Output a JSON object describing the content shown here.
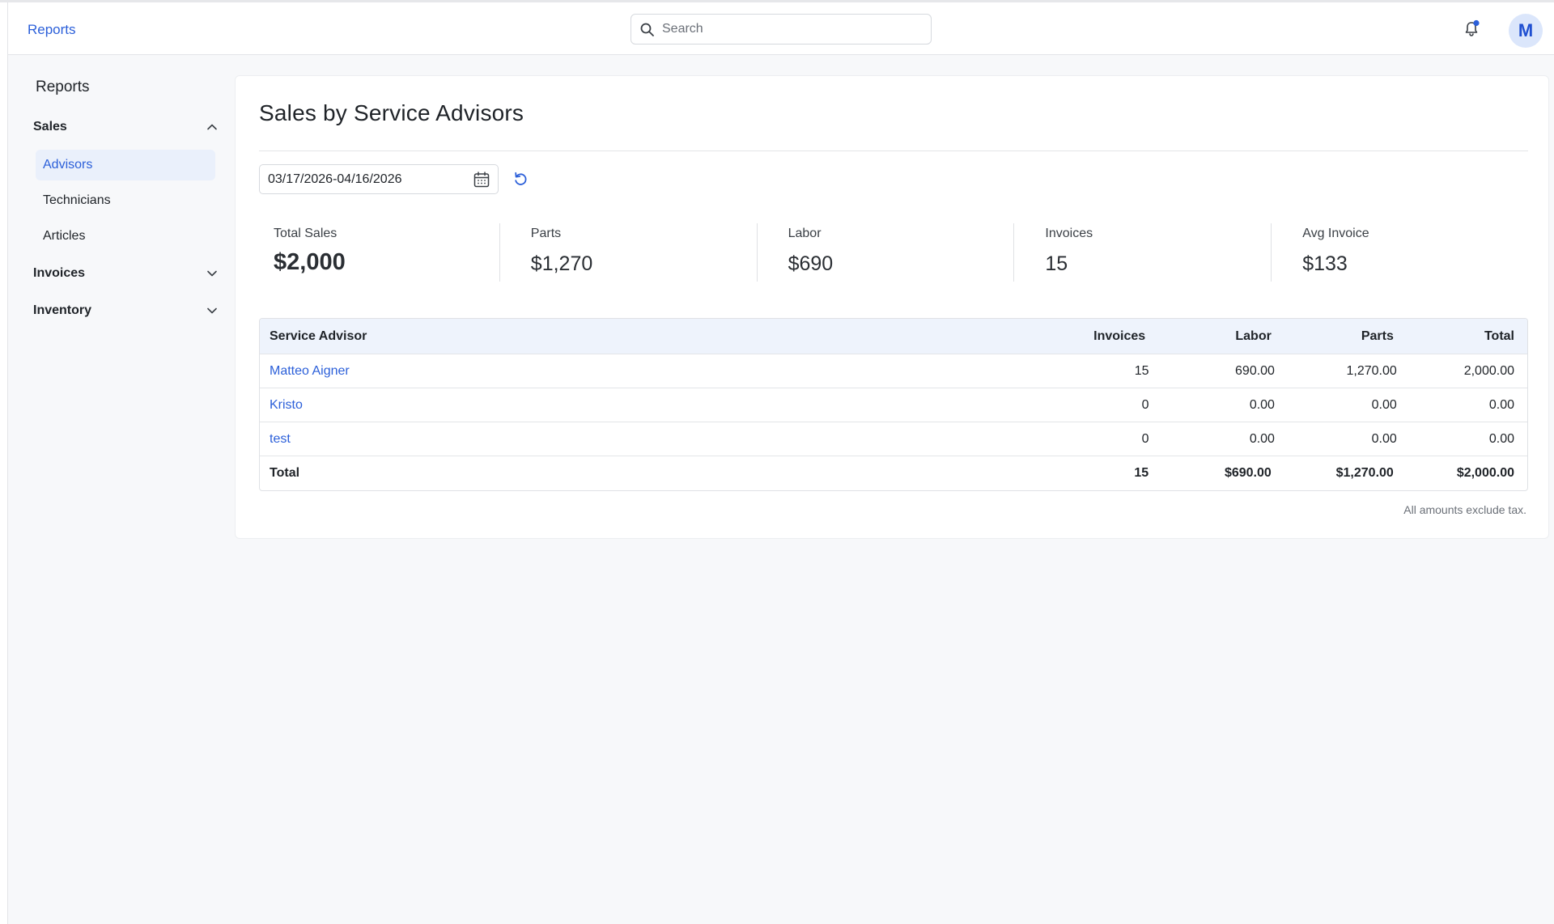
{
  "topbar": {
    "breadcrumb": "Reports",
    "search_placeholder": "Search",
    "avatar_initial": "M",
    "notification_dot_color": "#2b5fd9"
  },
  "sidebar": {
    "title": "Reports",
    "groups": [
      {
        "label": "Sales",
        "expanded": true,
        "items": [
          "Advisors",
          "Technicians",
          "Articles"
        ],
        "active_item": "Advisors"
      },
      {
        "label": "Invoices",
        "expanded": false
      },
      {
        "label": "Inventory",
        "expanded": false
      }
    ]
  },
  "main": {
    "title": "Sales by Service Advisors",
    "date_range": "03/17/2026-04/16/2026",
    "kpis": [
      {
        "label": "Total Sales",
        "value": "$2,000"
      },
      {
        "label": "Parts",
        "value": "$1,270"
      },
      {
        "label": "Labor",
        "value": "$690"
      },
      {
        "label": "Invoices",
        "value": "15"
      },
      {
        "label": "Avg Invoice",
        "value": "$133"
      }
    ],
    "table": {
      "headers": [
        "Service Advisor",
        "Invoices",
        "Labor",
        "Parts",
        "Total"
      ],
      "rows": [
        [
          "Matteo Aigner",
          "15",
          "690.00",
          "1,270.00",
          "2,000.00"
        ],
        [
          "Kristo",
          "0",
          "0.00",
          "0.00",
          "0.00"
        ],
        [
          "test",
          "0",
          "0.00",
          "0.00",
          "0.00"
        ]
      ],
      "total": [
        "Total",
        "15",
        "$690.00",
        "$1,270.00",
        "$2,000.00"
      ]
    },
    "footnote": "All amounts exclude tax."
  },
  "colors": {
    "accent": "#2b5fd9",
    "table_header_bg": "#eef3fc",
    "active_item_bg": "#eaf0fb",
    "page_bg": "#f7f8fa"
  }
}
